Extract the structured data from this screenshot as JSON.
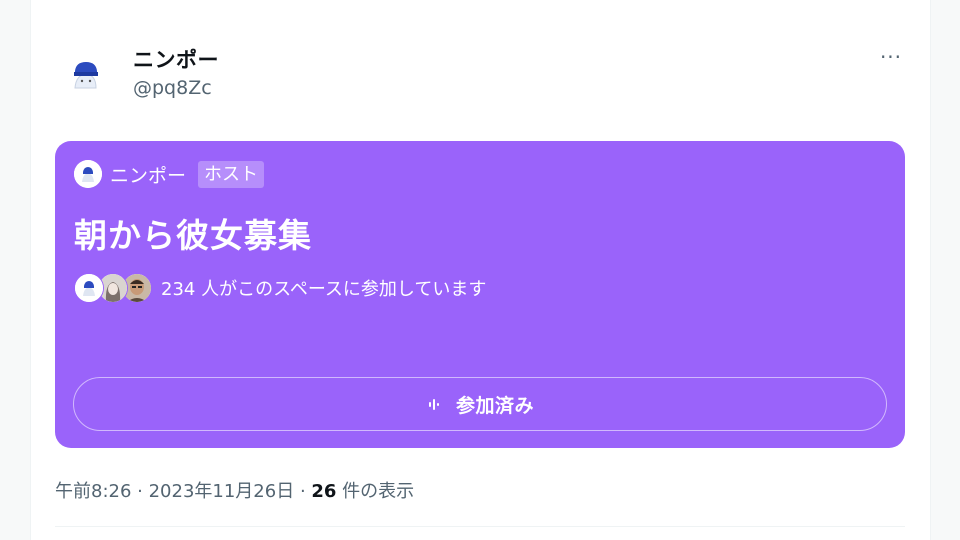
{
  "post": {
    "author_name": "ニンポー",
    "author_handle": "@pq8Zc",
    "more_icon": "more-horizontal-icon",
    "more_label": "···"
  },
  "space": {
    "card_color": "#9a63fa",
    "host_name": "ニンポー",
    "host_badge": "ホスト",
    "title": "朝から彼女募集",
    "participants_text": "234 人がこのスペースに参加しています",
    "join_icon": "audio-bars-icon",
    "join_label": "参加済み"
  },
  "meta": {
    "time": "午前8:26",
    "sep1": " · ",
    "date": "2023年11月26日",
    "sep2": " · ",
    "views_count": "26",
    "views_label": " 件の表示"
  }
}
